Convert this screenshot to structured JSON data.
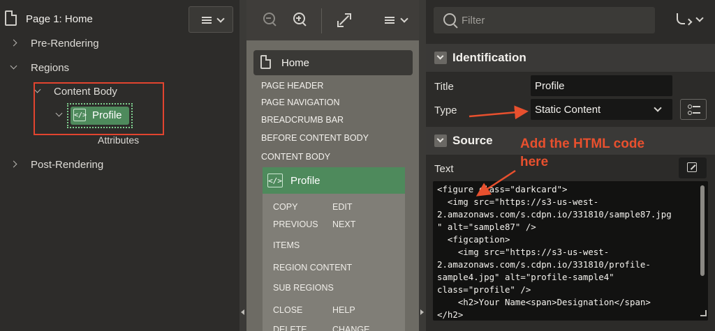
{
  "left": {
    "title": "Page 1: Home",
    "tree": {
      "pre_rendering": "Pre-Rendering",
      "regions": "Regions",
      "content_body": "Content Body",
      "profile": "Profile",
      "attributes": "Attributes",
      "post_rendering": "Post-Rendering"
    },
    "profile_icon": "</>"
  },
  "middle": {
    "home": "Home",
    "positions": [
      "PAGE HEADER",
      "PAGE NAVIGATION",
      "BREADCRUMB BAR",
      "BEFORE CONTENT BODY",
      "CONTENT BODY"
    ],
    "region": {
      "title": "Profile",
      "icon": "</>",
      "actions": {
        "copy": "COPY",
        "edit": "EDIT",
        "previous": "PREVIOUS",
        "next": "NEXT",
        "items": "ITEMS",
        "region_content": "REGION CONTENT",
        "sub_regions": "SUB REGIONS",
        "close": "CLOSE",
        "help": "HELP",
        "delete": "DELETE",
        "change": "CHANGE"
      }
    }
  },
  "right": {
    "filter_placeholder": "Filter",
    "identification": {
      "title": "Identification",
      "title_label": "Title",
      "title_value": "Profile",
      "type_label": "Type",
      "type_value": "Static Content"
    },
    "source": {
      "title": "Source",
      "text_label": "Text",
      "code_lines": [
        "<figure class=\"darkcard\">",
        "  <img src=\"https://s3-us-west-",
        "2.amazonaws.com/s.cdpn.io/331810/sample87.jpg",
        "\" alt=\"sample87\" />",
        "  <figcaption>",
        "    <img src=\"https://s3-us-west-",
        "2.amazonaws.com/s.cdpn.io/331810/profile-",
        "sample4.jpg\" alt=\"profile-sample4\"",
        "class=\"profile\" />",
        "    <h2>Your Name<span>Designation</span>",
        "</h2>"
      ]
    },
    "annotation": [
      "Add the HTML code",
      "here"
    ]
  },
  "colors": {
    "accent_red": "#e8502e",
    "region_green": "#4e8a5c"
  }
}
